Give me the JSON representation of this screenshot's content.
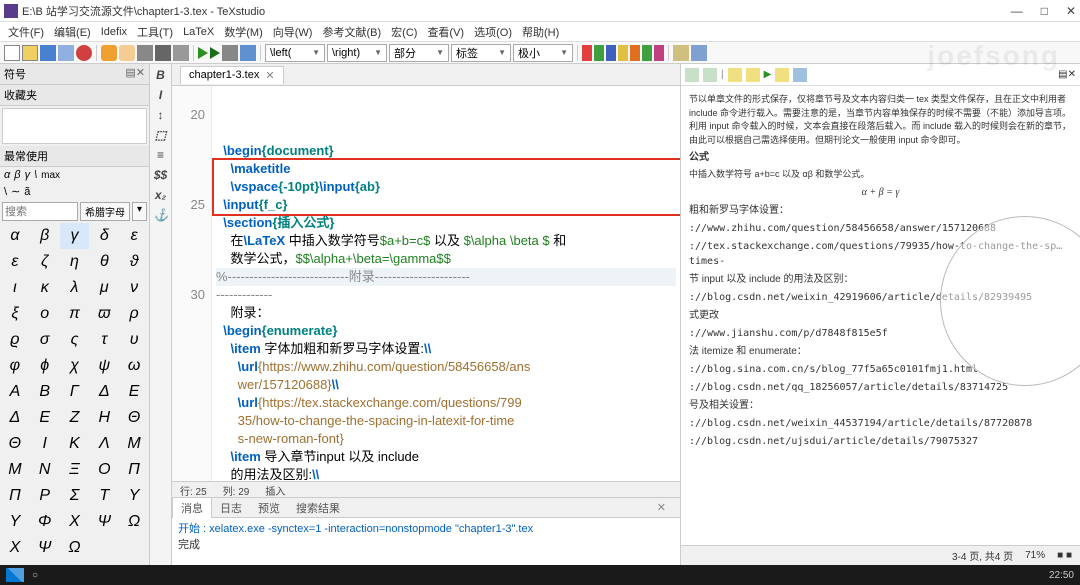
{
  "title": "E:\\B 站学习交流源文件\\chapter1-3.tex - TeXstudio",
  "menu": [
    "文件(F)",
    "编辑(E)",
    "Idefix",
    "工具(T)",
    "LaTeX",
    "数学(M)",
    "向导(W)",
    "参考文献(B)",
    "宏(C)",
    "查看(V)",
    "选项(O)",
    "帮助(H)"
  ],
  "toolbar_combos": [
    "\\left(",
    "\\right)",
    "部分",
    "标签",
    "极小"
  ],
  "left": {
    "title": "符号",
    "fav": "收藏夹",
    "most": "最常使用",
    "row1": [
      "α",
      "β",
      "γ",
      "\\",
      "max"
    ],
    "row2": [
      "\\",
      "∼",
      "ã",
      "",
      ""
    ],
    "search_ph": "搜索",
    "greek_btn": "希腊字母",
    "symbols": [
      "α",
      "β",
      "γ",
      "δ",
      "ε",
      "ε",
      "ζ",
      "η",
      "θ",
      "ϑ",
      "ι",
      "κ",
      "λ",
      "μ",
      "ν",
      "ξ",
      "o",
      "π",
      "ϖ",
      "ρ",
      "ϱ",
      "σ",
      "ς",
      "τ",
      "υ",
      "φ",
      "ϕ",
      "χ",
      "ψ",
      "ω",
      "A",
      "B",
      "Γ",
      "Δ",
      "E",
      "Δ",
      "E",
      "Z",
      "H",
      "Θ",
      "Θ",
      "I",
      "K",
      "Λ",
      "M",
      "M",
      "N",
      "Ξ",
      "O",
      "Π",
      "Π",
      "P",
      "Σ",
      "T",
      "Υ",
      "Υ",
      "Φ",
      "X",
      "Ψ",
      "Ω",
      "X",
      "Ψ",
      "Ω",
      "",
      ""
    ]
  },
  "tab": {
    "name": "chapter1-3.tex"
  },
  "gutter": [
    "",
    "20",
    "",
    "",
    "",
    "",
    "25",
    "",
    "",
    "",
    "",
    "30",
    "",
    "",
    "",
    "",
    "",
    ""
  ],
  "code_lines": [
    {
      "t": "cmd",
      "c": "\\begin",
      "a": "{document}"
    },
    {
      "t": "cmd2",
      "c": "\\maketitle"
    },
    {
      "t": "vsp",
      "c": "\\vspace",
      "a": "{-10pt}",
      "c2": "\\input",
      "a2": "{ab}"
    },
    {
      "t": "cmd",
      "c": "\\input",
      "a": "{f_c}"
    },
    {
      "t": "cmd",
      "c": "\\section",
      "a": "{插入公式}"
    },
    {
      "t": "txt",
      "pre": "在",
      "c": "\\LaTeX",
      "mid": " 中插入数学符号",
      "m1": "$a+b=c$",
      "mid2": " 以及 ",
      "m2": "$\\alpha \\beta $",
      "end": " 和"
    },
    {
      "t": "txt2",
      "pre": "数学公式，",
      "m": "$$\\alpha+\\beta=\\gamma$$"
    },
    {
      "t": "hl",
      "c": "%----------------------------附录----------------------"
    },
    {
      "t": "dash",
      "c": "-------------"
    },
    {
      "t": "plain",
      "c": "附录："
    },
    {
      "t": "cmd",
      "c": "\\begin",
      "a": "{enumerate}"
    },
    {
      "t": "item",
      "c": "\\item",
      "txt": " 字体加粗和新罗马字体设置:",
      "tail": "\\\\"
    },
    {
      "t": "url",
      "c": "\\url",
      "a": "{https://www.zhihu.com/question/58456658/ans"
    },
    {
      "t": "urlc",
      "a": "wer/157120688}",
      "tail": "\\\\"
    },
    {
      "t": "url",
      "c": "\\url",
      "a": "{https://tex.stackexchange.com/questions/799"
    },
    {
      "t": "urlc2",
      "a": "35/how-to-change-the-spacing-in-latexit-for-time"
    },
    {
      "t": "urlc",
      "a": "s-new-roman-font}"
    },
    {
      "t": "item",
      "c": "\\item",
      "txt": " 导入章节input 以及 include"
    },
    {
      "t": "plain",
      "c": "的用法及区别:",
      "tail": "\\\\"
    },
    {
      "t": "url",
      "c": "\\url",
      "a": "{https://blog.csdn.net/weixin_42919606/artic"
    },
    {
      "t": "urlc",
      "a": "le/details/82939495}"
    }
  ],
  "status_ed": {
    "line": "行: 25",
    "col": "列: 29",
    "mode": "插入"
  },
  "bottom_tabs": [
    "消息",
    "日志",
    "预览",
    "搜索结果"
  ],
  "log": {
    "l1": "开始 : xelatex.exe -synctex=1 -interaction=nonstopmode \"chapter1-3\".tex",
    "l2": "完成"
  },
  "preview": {
    "p1": "节以单章文件的形式保存，仅将章节号及文本内容归类一 tex 类型文件保存，且在正文中利用者 include 命令进行载入。需要注意的是，当章节内容单独保存的时候不需要（不能）添加导言项。利用 input 命令载入的时候，文本会直接在段落后载入。而 include 载入的时候则会在新的章节，由此可以根据自己需选择使用。但期刊论文一般使用 input 命令即可。",
    "h1": "公式",
    "p2": "中插入数学符号 a+b=c 以及 αβ 和数学公式。",
    "eq": "α + β = γ",
    "h2": "粗和新罗马字体设置：",
    "u1": "://www.zhihu.com/question/58456658/answer/157120688",
    "u2": "://tex.stackexchange.com/questions/79935/how-to-change-the-sp…    times-",
    "h3": "节 input 以及 include 的用法及区别：",
    "u3": "://blog.csdn.net/weixin_42919606/article/details/82939495",
    "h4": "式更改",
    "u4": "://www.jianshu.com/p/d7848f815e5f",
    "h5": "法 itemize 和 enumerate：",
    "u5": "://blog.sina.com.cn/s/blog_77f5a65c0101fmj1.html",
    "u6": "://blog.csdn.net/qq_18256057/article/details/83714725",
    "h6": "号及相关设置：",
    "u7": "://blog.csdn.net/weixin_44537194/article/details/87720878",
    "u8": "://blog.csdn.net/ujsdui/article/details/79075327"
  },
  "statusbar": {
    "pages": "3-4 页, 共4 页",
    "zoom": "71%",
    "st": "■ ■"
  },
  "taskbar_time": "22:50",
  "watermark": "joefsong"
}
